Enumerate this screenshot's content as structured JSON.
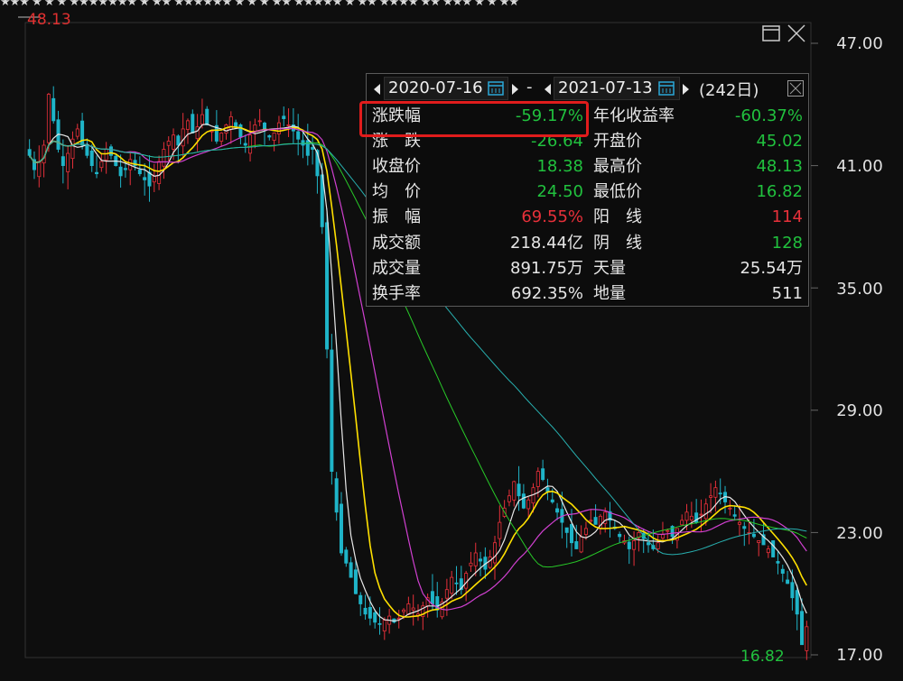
{
  "chart_data": {
    "type": "candlestick",
    "yaxis": {
      "ticks": [
        "47.00",
        "41.00",
        "35.00",
        "29.00",
        "23.00",
        "17.00"
      ],
      "ylim": [
        17,
        47.8
      ]
    },
    "markers": {
      "max_label": "48.13",
      "min_label": "16.82"
    },
    "closes": [
      41.5,
      40.8,
      41.2,
      42.0,
      44.5,
      43.2,
      41.8,
      41.0,
      41.6,
      42.3,
      42.8,
      42.0,
      41.5,
      41.0,
      40.6,
      41.2,
      41.8,
      41.5,
      41.0,
      40.5,
      40.8,
      41.3,
      41.0,
      40.6,
      40.3,
      40.0,
      40.5,
      41.2,
      41.8,
      42.2,
      42.5,
      42.0,
      42.8,
      43.2,
      42.6,
      42.9,
      43.5,
      43.0,
      42.7,
      42.2,
      42.6,
      43.0,
      43.4,
      42.9,
      42.4,
      42.0,
      42.5,
      43.0,
      43.2,
      42.8,
      42.4,
      42.6,
      43.1,
      43.3,
      43.0,
      42.7,
      42.3,
      42.0,
      41.5,
      41.8,
      40.5,
      38.0,
      32.0,
      26.0,
      24.0,
      22.0,
      21.5,
      20.8,
      20.0,
      19.5,
      19.0,
      18.8,
      18.6,
      18.5,
      18.7,
      18.9,
      18.6,
      18.8,
      19.2,
      19.5,
      19.3,
      19.0,
      19.4,
      19.8,
      19.5,
      19.2,
      19.6,
      20.2,
      20.8,
      20.5,
      20.2,
      21.0,
      21.5,
      22.0,
      21.6,
      21.2,
      21.8,
      22.5,
      23.5,
      24.2,
      24.8,
      25.5,
      24.8,
      24.2,
      24.6,
      25.2,
      26.0,
      25.6,
      25.0,
      24.5,
      24.0,
      23.5,
      23.0,
      22.5,
      22.2,
      22.8,
      23.2,
      23.6,
      23.4,
      23.8,
      24.0,
      23.6,
      23.2,
      22.8,
      22.6,
      22.2,
      22.6,
      23.0,
      22.7,
      22.4,
      22.2,
      22.5,
      22.9,
      23.1,
      22.8,
      23.2,
      23.6,
      24.0,
      23.8,
      23.5,
      23.9,
      24.4,
      24.8,
      25.2,
      24.9,
      24.5,
      24.2,
      23.8,
      23.5,
      23.2,
      23.0,
      22.8,
      22.6,
      22.4,
      22.2,
      21.8,
      21.5,
      21.0,
      20.5,
      19.8,
      19.0,
      17.5,
      18.38
    ]
  },
  "info_panel": {
    "start_date": "2020-07-16",
    "dash": "-",
    "end_date": "2021-07-13",
    "days": "(242日)",
    "rows": [
      {
        "l1": "涨跌幅",
        "v1": "-59.17%",
        "c1": "green",
        "l2": "年化收益率",
        "v2": "-60.37%",
        "c2": "green"
      },
      {
        "l1": "涨　跌",
        "v1": "-26.64",
        "c1": "green",
        "l2": "开盘价",
        "v2": "45.02",
        "c2": "green"
      },
      {
        "l1": "收盘价",
        "v1": "18.38",
        "c1": "green",
        "l2": "最高价",
        "v2": "48.13",
        "c2": "green"
      },
      {
        "l1": "均　价",
        "v1": "24.50",
        "c1": "green",
        "l2": "最低价",
        "v2": "16.82",
        "c2": "green"
      },
      {
        "l1": "振　幅",
        "v1": "69.55%",
        "c1": "red",
        "l2": "阳　线",
        "v2": "114",
        "c2": "red"
      },
      {
        "l1": "成交额",
        "v1": "218.44亿",
        "c1": "white",
        "l2": "阴　线",
        "v2": "128",
        "c2": "green"
      },
      {
        "l1": "成交量",
        "v1": "891.75万",
        "c1": "white",
        "l2": "天量",
        "v2": "25.54万",
        "c2": "white"
      },
      {
        "l1": "换手率",
        "v1": "692.35%",
        "c1": "white",
        "l2": "地量",
        "v2": "511",
        "c2": "white"
      }
    ]
  },
  "colors": {
    "up": "#e8303a",
    "down": "#1fb4c8",
    "ma5": "#e8e8e8",
    "ma10": "#ffe000",
    "ma20": "#d040d0",
    "ma60": "#28c828",
    "ma120": "#28b0b0",
    "green_text": "#21c13e",
    "highlight": "#e01c1c"
  },
  "icons": {
    "maximize": "restore-window-icon",
    "close": "close-icon",
    "calendar": "calendar-icon"
  },
  "top_stars": "★★★ ★ ★ ★ ★★★★★★★ ★   ★★  ★★★★★★   ★ ★ ★ ★★ ★★★★★ ★  ★★ ★★★★ ★★ ★★★ ★ ★  ★★"
}
